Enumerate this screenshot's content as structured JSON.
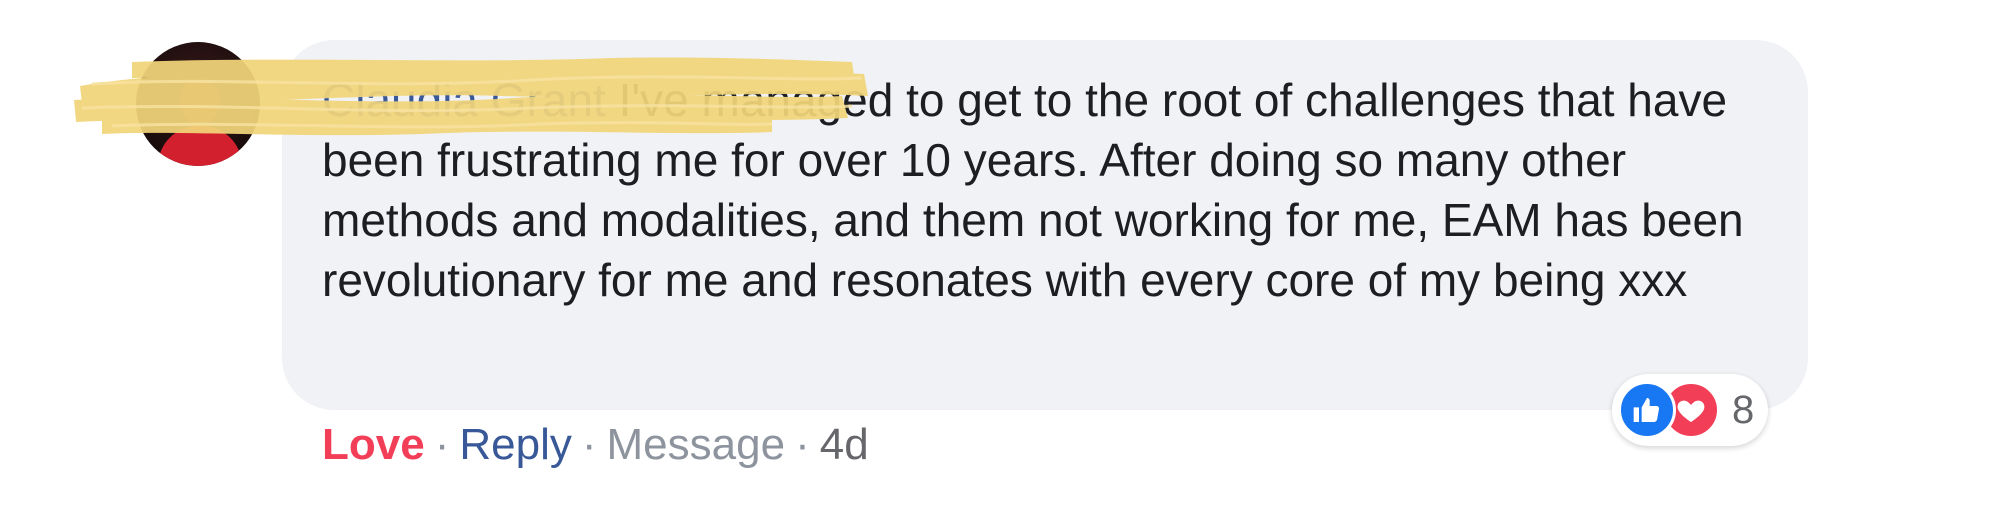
{
  "comment": {
    "author": "Claudia Grant",
    "text": " I've managed to get to the root of challenges that have been frustrating me for over 10 years. After doing so many other methods and modalities, and them not working for me, EAM has been revolutionary for me and resonates with every core of my being xxx"
  },
  "actions": {
    "love": "Love",
    "reply": "Reply",
    "message": "Message",
    "separator": "·",
    "timestamp": "4d"
  },
  "reactions": {
    "icons": [
      "like-icon",
      "love-icon"
    ],
    "count": "8",
    "colors": {
      "like": "#1877f2",
      "love": "#f33e58"
    }
  },
  "colors": {
    "bubble": "#f0f2f5",
    "author_link": "#385898",
    "love_action": "#f33e58",
    "muted": "#8d949e"
  }
}
